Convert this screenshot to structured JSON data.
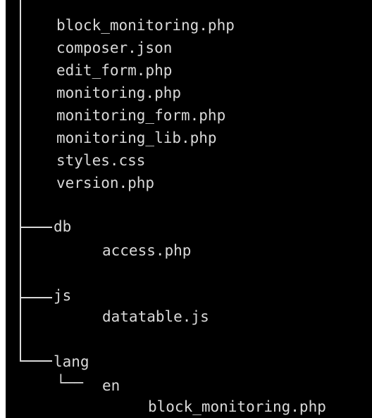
{
  "tree": {
    "root_files": [
      "block_monitoring.php",
      "composer.json",
      "edit_form.php",
      "monitoring.php",
      "monitoring_form.php",
      "monitoring_lib.php",
      "styles.css",
      "version.php"
    ],
    "folders": {
      "db": {
        "name": "db",
        "files": [
          "access.php"
        ]
      },
      "js": {
        "name": "js",
        "files": [
          "datatable.js"
        ]
      },
      "lang": {
        "name": "lang",
        "sub_folder": "en",
        "sub_files": [
          "block_monitoring.php"
        ]
      }
    },
    "sub_connector": "└──"
  },
  "colors": {
    "background": "#000000",
    "text": "#d9d9d9",
    "left_border": "#ffffff"
  }
}
